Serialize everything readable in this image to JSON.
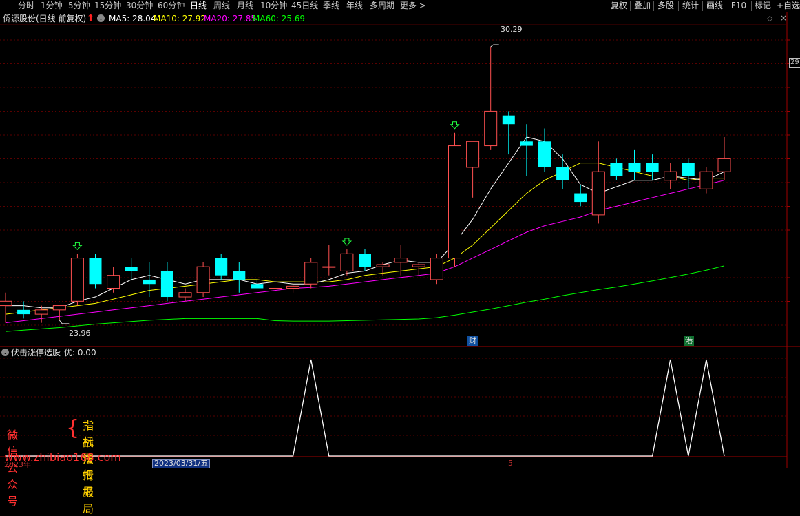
{
  "toolbar": {
    "periods": [
      {
        "label": "分时"
      },
      {
        "label": "1分钟"
      },
      {
        "label": "5分钟"
      },
      {
        "label": "15分钟"
      },
      {
        "label": "30分钟"
      },
      {
        "label": "60分钟"
      },
      {
        "label": "日线",
        "active": true
      },
      {
        "label": "周线"
      },
      {
        "label": "月线"
      },
      {
        "label": "10分钟"
      },
      {
        "label": "45日线"
      },
      {
        "label": "季线"
      },
      {
        "label": "年线"
      },
      {
        "label": "多周期"
      },
      {
        "label": "更多 >"
      }
    ],
    "actions": [
      {
        "label": "复权"
      },
      {
        "label": "叠加"
      },
      {
        "label": "多股"
      },
      {
        "label": "统计"
      },
      {
        "label": "画线"
      },
      {
        "label": "F10"
      },
      {
        "label": "标记"
      },
      {
        "label": "+自选"
      }
    ]
  },
  "infobar": {
    "stock": "侨源股份(日线 前复权)",
    "ma5": "MA5: 28.04",
    "ma10": "MA10: 27.92",
    "ma20": "MA20: 27.85",
    "ma60": "MA60: 25.69",
    "colors": {
      "ma5": "#ffffff",
      "ma10": "#ffff00",
      "ma20": "#ff00ff",
      "ma60": "#00ff00"
    }
  },
  "price_labels": {
    "high": "30.29",
    "low": "23.96",
    "axis_tick": "29"
  },
  "event_markers": {
    "cai": "财",
    "gang": "港"
  },
  "sub_indicator": {
    "label": "伏击涨停选股",
    "value": "优: 0.00"
  },
  "bottom_axis": {
    "year": "2023年",
    "cursor_date": "2023/03/31/五",
    "month_tick": "5"
  },
  "watermark": {
    "left": "微信公众号",
    "line1": "指标情报局",
    "line2": "战法情报局",
    "url": "www.zhibiao168.com"
  },
  "chart_data": {
    "type": "candlestick",
    "colors": {
      "up": "#ff5050",
      "down": "#00ffff",
      "ma5": "#ffffff",
      "ma10": "#ffff00",
      "ma20": "#ff00ff",
      "ma60": "#00ff00",
      "signal": "#ffffff"
    },
    "ohlc": [
      [
        24.3,
        24.6,
        23.9,
        24.4
      ],
      [
        24.2,
        24.4,
        24.0,
        24.1
      ],
      [
        24.1,
        24.3,
        23.9,
        24.2
      ],
      [
        24.2,
        24.3,
        23.96,
        24.3
      ],
      [
        24.4,
        25.5,
        24.3,
        25.4
      ],
      [
        25.4,
        25.5,
        24.7,
        24.8
      ],
      [
        24.7,
        25.2,
        24.6,
        25.0
      ],
      [
        25.2,
        25.4,
        24.9,
        25.1
      ],
      [
        24.9,
        25.3,
        24.5,
        24.8
      ],
      [
        25.1,
        25.3,
        24.4,
        24.5
      ],
      [
        24.5,
        24.7,
        24.4,
        24.6
      ],
      [
        24.6,
        25.3,
        24.5,
        25.2
      ],
      [
        25.4,
        25.5,
        24.9,
        25.0
      ],
      [
        25.1,
        25.3,
        24.6,
        24.9
      ],
      [
        24.8,
        24.9,
        24.7,
        24.7
      ],
      [
        24.7,
        24.8,
        24.1,
        24.7
      ],
      [
        24.7,
        24.8,
        24.6,
        24.75
      ],
      [
        24.8,
        25.4,
        24.7,
        25.3
      ],
      [
        25.2,
        25.7,
        25.0,
        25.2
      ],
      [
        25.1,
        25.6,
        25.0,
        25.5
      ],
      [
        25.5,
        25.6,
        25.1,
        25.2
      ],
      [
        25.2,
        25.3,
        25.0,
        25.25
      ],
      [
        25.3,
        25.7,
        25.0,
        25.4
      ],
      [
        25.2,
        25.3,
        25.0,
        25.25
      ],
      [
        24.9,
        25.5,
        24.8,
        25.4
      ],
      [
        25.4,
        28.3,
        25.2,
        28.0
      ],
      [
        27.5,
        28.1,
        26.8,
        28.1
      ],
      [
        28.0,
        30.29,
        27.9,
        28.8
      ],
      [
        28.7,
        28.8,
        27.8,
        28.5
      ],
      [
        28.1,
        28.5,
        27.3,
        28.0
      ],
      [
        28.1,
        28.4,
        27.4,
        27.5
      ],
      [
        27.5,
        27.8,
        27.0,
        27.2
      ],
      [
        26.9,
        27.1,
        26.6,
        26.7
      ],
      [
        26.4,
        28.1,
        26.2,
        27.4
      ],
      [
        27.6,
        27.7,
        27.2,
        27.3
      ],
      [
        27.6,
        27.9,
        27.2,
        27.4
      ],
      [
        27.6,
        27.8,
        27.2,
        27.4
      ],
      [
        27.2,
        27.6,
        27.0,
        27.4
      ],
      [
        27.6,
        27.7,
        27.0,
        27.3
      ],
      [
        27.0,
        27.5,
        26.9,
        27.4
      ],
      [
        27.4,
        28.2,
        27.2,
        27.7
      ]
    ],
    "ma5": [
      24.3,
      24.3,
      24.25,
      24.25,
      24.4,
      24.5,
      24.7,
      24.9,
      25.0,
      24.9,
      24.8,
      24.9,
      24.9,
      24.9,
      24.8,
      24.85,
      24.8,
      24.8,
      24.9,
      25.05,
      25.1,
      25.25,
      25.35,
      25.3,
      25.3,
      25.75,
      26.3,
      27.0,
      27.6,
      28.2,
      28.1,
      27.7,
      27.1,
      26.9,
      27.05,
      27.2,
      27.2,
      27.3,
      27.25,
      27.2,
      27.4
    ],
    "ma10": [
      24.1,
      24.15,
      24.2,
      24.25,
      24.3,
      24.35,
      24.45,
      24.55,
      24.65,
      24.7,
      24.75,
      24.8,
      24.85,
      24.9,
      24.9,
      24.85,
      24.85,
      24.85,
      24.85,
      24.9,
      25.0,
      25.05,
      25.1,
      25.15,
      25.2,
      25.4,
      25.7,
      26.1,
      26.5,
      26.9,
      27.2,
      27.4,
      27.6,
      27.6,
      27.5,
      27.4,
      27.3,
      27.3,
      27.2,
      27.25,
      27.25
    ],
    "ma20": [
      23.9,
      23.95,
      24.0,
      24.05,
      24.1,
      24.15,
      24.2,
      24.25,
      24.3,
      24.35,
      24.4,
      24.45,
      24.5,
      24.55,
      24.6,
      24.65,
      24.7,
      24.72,
      24.75,
      24.8,
      24.85,
      24.9,
      24.95,
      25.0,
      25.05,
      25.2,
      25.4,
      25.6,
      25.8,
      26.0,
      26.15,
      26.25,
      26.35,
      26.5,
      26.6,
      26.7,
      26.8,
      26.9,
      27.0,
      27.1,
      27.2
    ],
    "ma60": [
      23.7,
      23.73,
      23.76,
      23.79,
      23.83,
      23.87,
      23.9,
      23.93,
      23.96,
      23.98,
      24.0,
      24.0,
      24.0,
      24.0,
      24.0,
      23.95,
      23.94,
      23.94,
      23.94,
      23.95,
      23.96,
      23.97,
      23.98,
      23.99,
      24.02,
      24.08,
      24.15,
      24.22,
      24.3,
      24.38,
      24.45,
      24.53,
      24.6,
      24.67,
      24.73,
      24.8,
      24.87,
      24.95,
      25.03,
      25.12,
      25.22
    ],
    "signal": [
      0,
      0,
      0,
      0,
      0,
      0,
      0,
      0,
      0,
      0,
      0,
      0,
      0,
      0,
      0,
      0,
      0,
      1,
      0,
      0,
      0,
      0,
      0,
      0,
      0,
      0,
      0,
      0,
      0,
      0,
      0,
      0,
      0,
      0,
      0,
      0,
      0,
      1,
      0,
      1,
      0
    ],
    "buy_arrows": [
      4,
      19,
      25
    ],
    "ylim": [
      23.4,
      30.8
    ]
  }
}
